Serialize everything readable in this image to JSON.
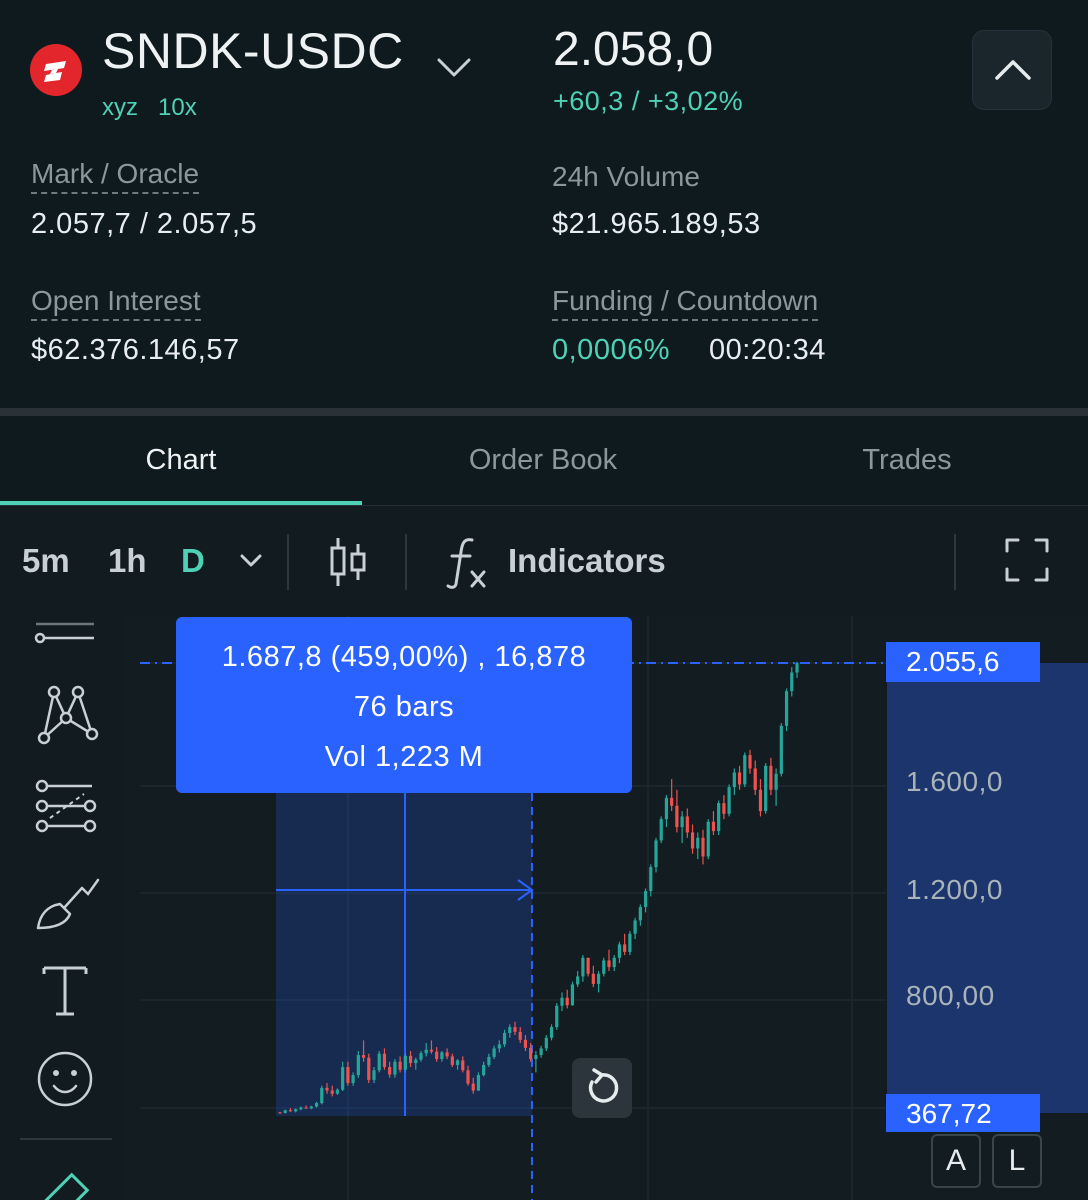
{
  "market": {
    "pair": "SNDK-USDC",
    "dex": "xyz",
    "leverage": "10x",
    "price": "2.058,0",
    "change": "+60,3 / +3,02%",
    "logo_color": "#e3262b"
  },
  "stats": {
    "mark_oracle_label": "Mark / Oracle",
    "mark_oracle_value": "2.057,7 / 2.057,5",
    "volume_label": "24h Volume",
    "volume_value": "$21.965.189,53",
    "open_interest_label": "Open Interest",
    "open_interest_value": "$62.376.146,57",
    "funding_label": "Funding / Countdown",
    "funding_rate": "0,0006%",
    "countdown": "00:20:34"
  },
  "tabs": [
    {
      "label": "Chart",
      "active": true
    },
    {
      "label": "Order Book",
      "active": false
    },
    {
      "label": "Trades",
      "active": false
    }
  ],
  "toolbar": {
    "timeframes": [
      "5m",
      "1h",
      "D"
    ],
    "active_timeframe": "D",
    "indicators_label": "Indicators"
  },
  "tools": [
    "horizontal-line-tool-icon",
    "pattern-tool-icon",
    "projection-tool-icon",
    "brush-tool-icon",
    "text-tool-icon",
    "emoji-tool-icon",
    "ruler-icon"
  ],
  "measure": {
    "line1": "1.687,8 (459,00%) , 16,878",
    "line2": "76 bars",
    "line3": "Vol 1,223 M"
  },
  "price_axis": {
    "current": "2.055,6",
    "labels": [
      "1.600,0",
      "1.200,0",
      "800,00"
    ],
    "low": "367,72"
  },
  "scale_buttons": [
    "A",
    "L"
  ],
  "colors": {
    "accent": "#4fd1b5",
    "measure_blue": "#2962ff",
    "up": "#26a69a",
    "down": "#ef5350"
  },
  "chart_data": {
    "type": "candlestick",
    "price_range": [
      367.72,
      2055.6
    ],
    "ohlc": [
      [
        370,
        372,
        365,
        368
      ],
      [
        368,
        380,
        366,
        378
      ],
      [
        378,
        386,
        372,
        374
      ],
      [
        374,
        385,
        370,
        382
      ],
      [
        382,
        392,
        378,
        388
      ],
      [
        388,
        396,
        384,
        385
      ],
      [
        385,
        395,
        382,
        392
      ],
      [
        392,
        410,
        388,
        405
      ],
      [
        405,
        470,
        400,
        462
      ],
      [
        462,
        480,
        440,
        452
      ],
      [
        452,
        470,
        430,
        440
      ],
      [
        440,
        460,
        436,
        455
      ],
      [
        455,
        560,
        450,
        540
      ],
      [
        540,
        560,
        470,
        480
      ],
      [
        480,
        520,
        470,
        510
      ],
      [
        510,
        600,
        500,
        585
      ],
      [
        585,
        640,
        560,
        575
      ],
      [
        575,
        590,
        480,
        492
      ],
      [
        492,
        540,
        480,
        528
      ],
      [
        528,
        600,
        520,
        590
      ],
      [
        590,
        610,
        530,
        540
      ],
      [
        540,
        560,
        500,
        512
      ],
      [
        512,
        570,
        500,
        560
      ],
      [
        560,
        580,
        520,
        530
      ],
      [
        530,
        590,
        520,
        582
      ],
      [
        582,
        600,
        540,
        555
      ],
      [
        555,
        575,
        530,
        568
      ],
      [
        568,
        600,
        560,
        592
      ],
      [
        592,
        630,
        580,
        605
      ],
      [
        605,
        640,
        590,
        598
      ],
      [
        598,
        615,
        560,
        570
      ],
      [
        570,
        600,
        560,
        595
      ],
      [
        595,
        610,
        570,
        580
      ],
      [
        580,
        590,
        540,
        548
      ],
      [
        548,
        570,
        530,
        565
      ],
      [
        565,
        580,
        520,
        528
      ],
      [
        528,
        545,
        470,
        478
      ],
      [
        478,
        500,
        440,
        452
      ],
      [
        452,
        520,
        450,
        510
      ],
      [
        510,
        560,
        505,
        548
      ],
      [
        548,
        590,
        540,
        578
      ],
      [
        578,
        620,
        570,
        610
      ],
      [
        610,
        640,
        595,
        625
      ],
      [
        625,
        680,
        615,
        668
      ],
      [
        668,
        700,
        650,
        690
      ],
      [
        690,
        710,
        660,
        672
      ],
      [
        672,
        690,
        630,
        642
      ],
      [
        642,
        660,
        600,
        612
      ],
      [
        612,
        630,
        560,
        570
      ],
      [
        570,
        600,
        520,
        585
      ],
      [
        585,
        620,
        575,
        610
      ],
      [
        610,
        660,
        600,
        650
      ],
      [
        650,
        700,
        640,
        690
      ],
      [
        690,
        780,
        680,
        770
      ],
      [
        770,
        820,
        750,
        800
      ],
      [
        800,
        830,
        760,
        772
      ],
      [
        772,
        860,
        770,
        850
      ],
      [
        850,
        900,
        840,
        880
      ],
      [
        880,
        960,
        860,
        950
      ],
      [
        950,
        940,
        880,
        890
      ],
      [
        890,
        920,
        840,
        852
      ],
      [
        852,
        900,
        820,
        890
      ],
      [
        890,
        950,
        880,
        940
      ],
      [
        940,
        980,
        900,
        915
      ],
      [
        915,
        960,
        900,
        950
      ],
      [
        950,
        1010,
        930,
        1000
      ],
      [
        1000,
        1040,
        960,
        972
      ],
      [
        972,
        1050,
        960,
        1040
      ],
      [
        1040,
        1100,
        1020,
        1090
      ],
      [
        1090,
        1150,
        1070,
        1140
      ],
      [
        1140,
        1210,
        1120,
        1200
      ],
      [
        1200,
        1300,
        1180,
        1290
      ],
      [
        1290,
        1400,
        1270,
        1390
      ],
      [
        1390,
        1480,
        1380,
        1470
      ],
      [
        1470,
        1560,
        1440,
        1550
      ],
      [
        1550,
        1620,
        1500,
        1520
      ],
      [
        1520,
        1580,
        1420,
        1440
      ],
      [
        1440,
        1500,
        1380,
        1480
      ],
      [
        1480,
        1510,
        1400,
        1420
      ],
      [
        1420,
        1450,
        1340,
        1360
      ],
      [
        1360,
        1420,
        1320,
        1400
      ],
      [
        1400,
        1430,
        1300,
        1330
      ],
      [
        1330,
        1470,
        1320,
        1460
      ],
      [
        1460,
        1500,
        1410,
        1425
      ],
      [
        1425,
        1540,
        1410,
        1530
      ],
      [
        1530,
        1560,
        1470,
        1490
      ],
      [
        1490,
        1600,
        1480,
        1590
      ],
      [
        1590,
        1660,
        1560,
        1645
      ],
      [
        1645,
        1670,
        1580,
        1600
      ],
      [
        1600,
        1720,
        1590,
        1710
      ],
      [
        1710,
        1730,
        1640,
        1660
      ],
      [
        1660,
        1690,
        1560,
        1580
      ],
      [
        1580,
        1620,
        1480,
        1500
      ],
      [
        1500,
        1680,
        1490,
        1670
      ],
      [
        1670,
        1700,
        1560,
        1580
      ],
      [
        1580,
        1660,
        1520,
        1640
      ],
      [
        1640,
        1830,
        1630,
        1820
      ],
      [
        1820,
        1960,
        1800,
        1950
      ],
      [
        1950,
        2040,
        1930,
        2020
      ],
      [
        2020,
        2060,
        2000,
        2055
      ]
    ]
  }
}
